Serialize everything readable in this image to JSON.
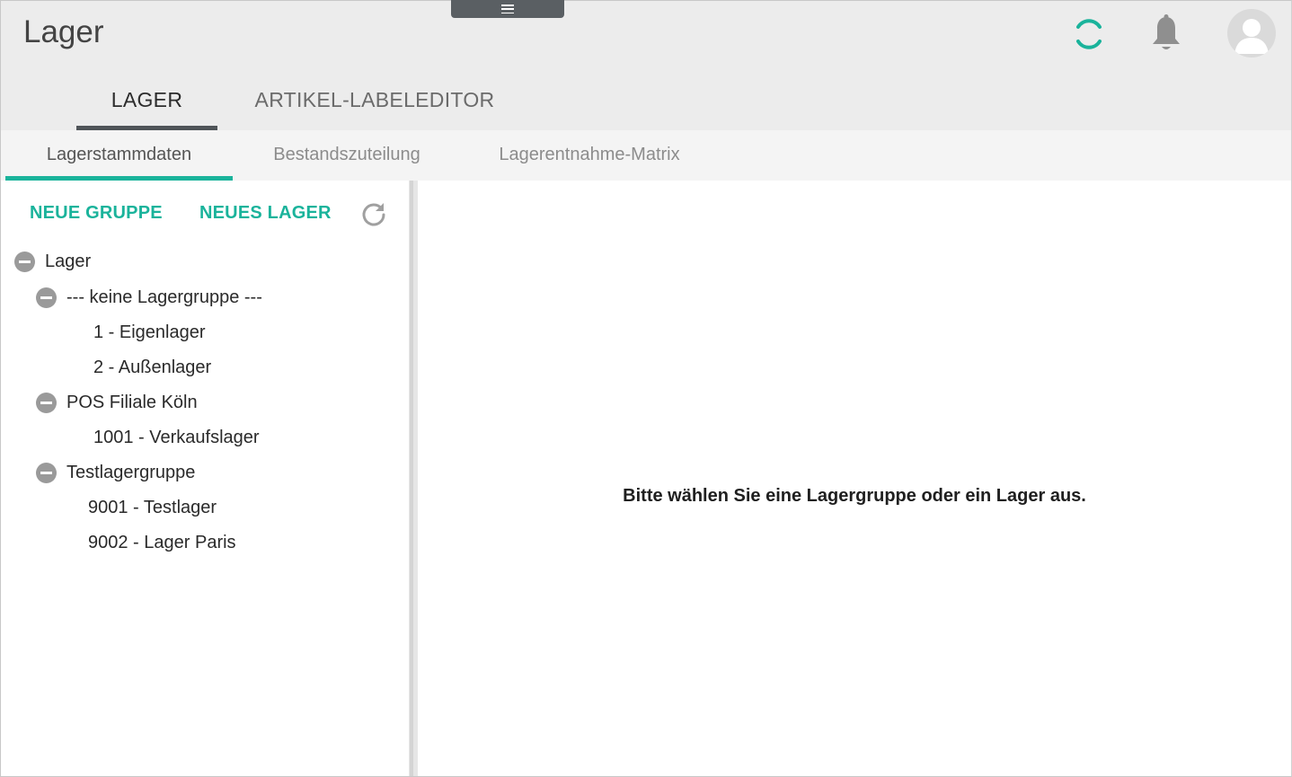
{
  "header": {
    "title": "Lager",
    "icons": {
      "menu": "menu-icon",
      "loading": "loading-spinner-icon",
      "notifications": "bell-icon",
      "user": "user-avatar-icon"
    },
    "accent_color": "#1ab39b"
  },
  "main_tabs": [
    {
      "label": "LAGER",
      "active": true
    },
    {
      "label": "ARTIKEL-LABELEDITOR",
      "active": false
    }
  ],
  "sub_tabs": [
    {
      "label": "Lagerstammdaten",
      "active": true
    },
    {
      "label": "Bestandszuteilung",
      "active": false
    },
    {
      "label": "Lagerentnahme-Matrix",
      "active": false
    }
  ],
  "toolbar": {
    "new_group": "NEUE GRUPPE",
    "new_warehouse": "NEUES LAGER",
    "refresh_icon": "refresh-icon"
  },
  "tree": {
    "root": "Lager",
    "groups": [
      {
        "label": "--- keine Lagergruppe ---",
        "items": [
          "1 - Eigenlager",
          "2 - Außenlager"
        ]
      },
      {
        "label": "POS Filiale Köln",
        "items": [
          "1001 - Verkaufslager"
        ]
      },
      {
        "label": "Testlagergruppe",
        "items": [
          "9001 - Testlager",
          "9002 - Lager Paris"
        ]
      }
    ]
  },
  "detail": {
    "placeholder": "Bitte wählen Sie eine Lagergruppe oder ein Lager aus."
  }
}
